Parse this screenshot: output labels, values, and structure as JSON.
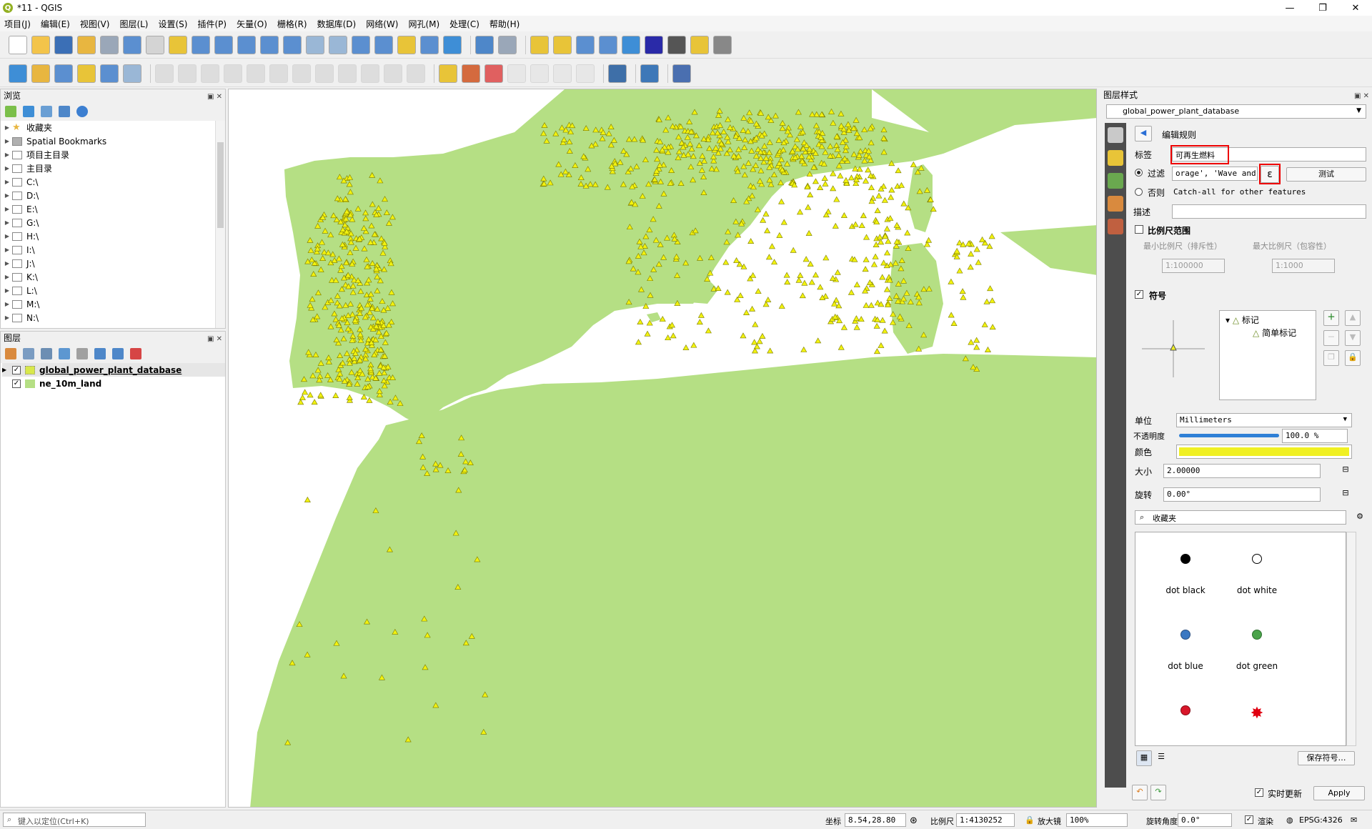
{
  "window": {
    "title": "*11 - QGIS",
    "logo": "Q",
    "controls": [
      "—",
      "❐",
      "✕"
    ]
  },
  "menu": [
    "项目(J)",
    "编辑(E)",
    "视图(V)",
    "图层(L)",
    "设置(S)",
    "插件(P)",
    "矢量(O)",
    "栅格(R)",
    "数据库(D)",
    "网络(W)",
    "网孔(M)",
    "处理(C)",
    "帮助(H)"
  ],
  "browser": {
    "title": "浏览",
    "items": [
      {
        "label": "收藏夹",
        "icon": "star-icon"
      },
      {
        "label": "Spatial Bookmarks",
        "icon": "bookmark-icon"
      },
      {
        "label": "项目主目录",
        "icon": "folder-icon"
      },
      {
        "label": "主目录",
        "icon": "home-icon"
      },
      {
        "label": "C:\\",
        "icon": "folder-icon"
      },
      {
        "label": "D:\\",
        "icon": "folder-icon"
      },
      {
        "label": "E:\\",
        "icon": "folder-icon"
      },
      {
        "label": "G:\\",
        "icon": "folder-icon"
      },
      {
        "label": "H:\\",
        "icon": "folder-icon"
      },
      {
        "label": "I:\\",
        "icon": "folder-icon"
      },
      {
        "label": "J:\\",
        "icon": "folder-icon"
      },
      {
        "label": "K:\\",
        "icon": "folder-icon"
      },
      {
        "label": "L:\\",
        "icon": "folder-icon"
      },
      {
        "label": "M:\\",
        "icon": "folder-icon"
      },
      {
        "label": "N:\\",
        "icon": "folder-icon"
      }
    ]
  },
  "layers": {
    "title": "图层",
    "items": [
      {
        "name": "global_power_plant_database",
        "checked": true,
        "underline": true,
        "swatch": "#d8e84a"
      },
      {
        "name": "ne_10m_land",
        "checked": true,
        "underline": false,
        "swatch": "#b5df84"
      }
    ]
  },
  "map": {
    "land_color": "#b5df84",
    "point_fill": "#f2f20f",
    "point_stroke": "#7a7a00",
    "water_color": "#ffffff"
  },
  "style": {
    "title": "图层样式",
    "layer_select": "global_power_plant_database",
    "edit_rule": "编辑规则",
    "label_caption": "标签",
    "label_value": "可再生燃料",
    "filter_caption": "过滤",
    "filter_value": "orage', 'Wave and Tidal')",
    "epsilon_icon": "ε",
    "test_button": "测试",
    "else_caption": "否则",
    "else_text": "Catch-all for other features",
    "desc_caption": "描述",
    "scale_caption": "比例尺范围",
    "min_scale_caption": "最小比例尺（排斥性）",
    "max_scale_caption": "最大比例尺（包容性）",
    "min_scale_value": "1:100000",
    "max_scale_value": "1:1000",
    "symbol_caption": "符号",
    "tree_marker": "标记",
    "tree_simple": "简单标记",
    "unit_caption": "单位",
    "unit_value": "Millimeters",
    "opacity_caption": "不透明度",
    "opacity_value": "100.0 %",
    "opacity_fraction": 1.0,
    "color_caption": "颜色",
    "color_value": "#f0f022",
    "size_caption": "大小",
    "size_value": "2.00000",
    "rotation_caption": "旋转",
    "rotation_value": "0.00°",
    "search_value": "收藏夹",
    "symbols": [
      {
        "label": "dot  black",
        "fill": "#000000",
        "stroke": "#000000"
      },
      {
        "label": "dot  white",
        "fill": "#ffffff",
        "stroke": "#000000"
      },
      {
        "label": "dot blue",
        "fill": "#3b78c2",
        "stroke": "#2a4f80"
      },
      {
        "label": "dot green",
        "fill": "#4aa34a",
        "stroke": "#2f7030"
      },
      {
        "label": "",
        "fill": "#d8162a",
        "stroke": "#8a0c18"
      },
      {
        "label": "",
        "fill": "#e00010",
        "stroke": "#b00000",
        "star": true
      }
    ],
    "save_symbol": "保存符号…",
    "live_update": "实时更新",
    "apply": "Apply"
  },
  "status": {
    "locator_placeholder": "键入以定位(Ctrl+K)",
    "coord_caption": "坐标",
    "coord_value": "8.54,28.80",
    "scale_caption": "比例尺",
    "scale_value": "1:4130252",
    "mag_caption": "放大镜",
    "mag_value": "100%",
    "rot_caption": "旋转角度",
    "rot_value": "0.0°",
    "render_caption": "渲染",
    "crs_value": "EPSG:4326"
  }
}
